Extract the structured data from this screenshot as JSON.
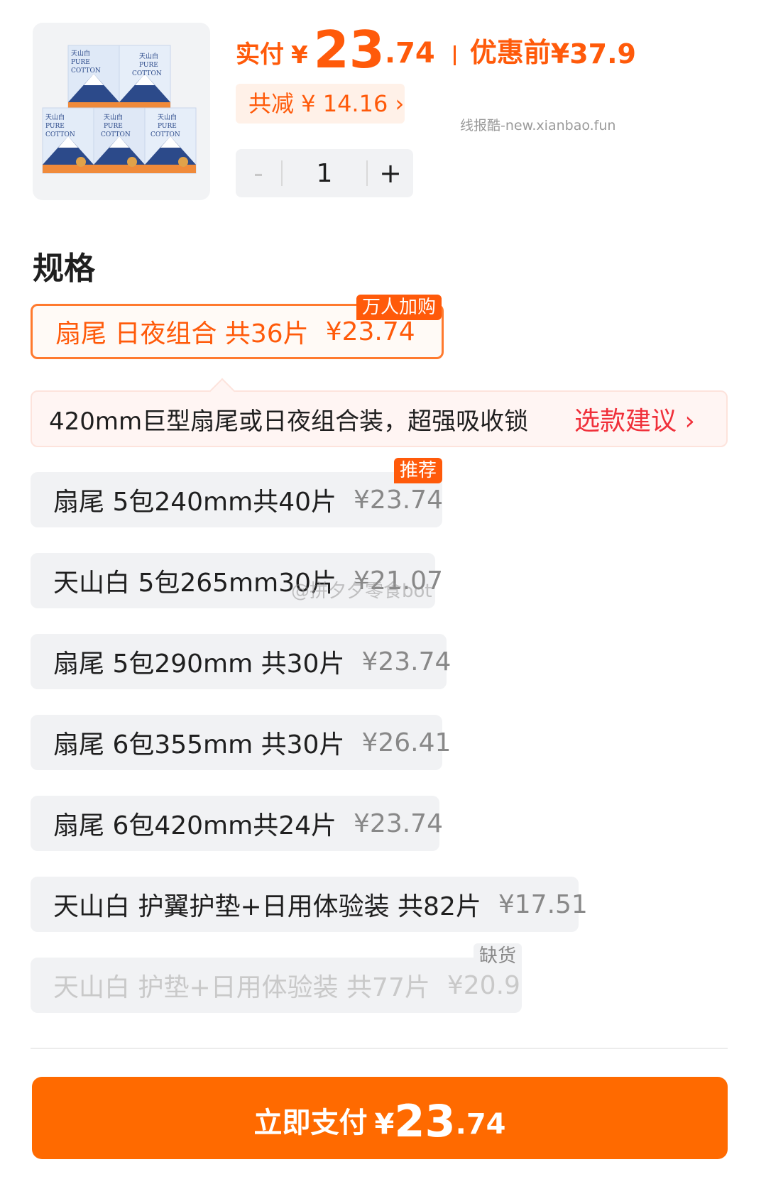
{
  "header": {
    "paid_label": "实付",
    "currency": "¥",
    "price_int": "23",
    "price_dec": ".74",
    "original_label": "优惠前",
    "original_price": "¥37.9",
    "discount_text": "共减 ¥ 14.16 ›",
    "watermark": "线报酷-new.xianbao.fun"
  },
  "product_image": {
    "brand_text": "天山白",
    "line1": "PURE",
    "line2": "COTTON"
  },
  "stepper": {
    "minus": "-",
    "qty": "1",
    "plus": "+"
  },
  "section_title": "规格",
  "tip": {
    "text": "420mm巨型扇尾或日夜组合装，超强吸收锁",
    "link": "选款建议 ›"
  },
  "overlay_watermark": "@拼夕夕零食bot",
  "specs": [
    {
      "name": "扇尾  日夜组合 共36片",
      "price": "¥23.74",
      "tag": "万人加购",
      "state": "selected"
    },
    {
      "name": "扇尾 5包240mm共40片",
      "price": "¥23.74",
      "tag": "推荐",
      "state": "normal"
    },
    {
      "name": "天山白 5包265mm30片",
      "price": "¥21.07",
      "tag": "",
      "state": "normal"
    },
    {
      "name": "扇尾 5包290mm 共30片",
      "price": "¥23.74",
      "tag": "",
      "state": "normal"
    },
    {
      "name": "扇尾 6包355mm 共30片",
      "price": "¥26.41",
      "tag": "",
      "state": "normal"
    },
    {
      "name": "扇尾 6包420mm共24片",
      "price": "¥23.74",
      "tag": "",
      "state": "normal"
    },
    {
      "name": "天山白 护翼护垫+日用体验装 共82片",
      "price": "¥17.51",
      "tag": "",
      "state": "normal"
    },
    {
      "name": "天山白 护垫+日用体验装 共77片",
      "price": "¥20.9",
      "tag": "缺货",
      "state": "disabled"
    }
  ],
  "pay_button": {
    "label": "立即支付",
    "currency": "¥",
    "price_int": "23",
    "price_dec": ".74"
  },
  "colors": {
    "accent": "#ff5a0a",
    "pay_button": "#ff6a00",
    "link_red": "#f0303a"
  }
}
